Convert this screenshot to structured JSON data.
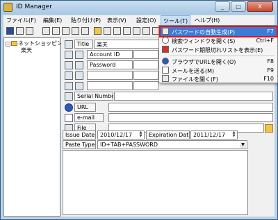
{
  "window": {
    "title": "ID Manager",
    "minimize": "_",
    "maximize": "□",
    "close": "X"
  },
  "menu": [
    "ファイル(F)",
    "編集(E)",
    "貼り付け(P)",
    "表示(V)",
    "設定(O)",
    "ツール(T)",
    "ヘルプ(H)"
  ],
  "tree": {
    "root": "ネットショッピング",
    "child": "楽天"
  },
  "form": {
    "title_label": "Title",
    "title_value": "楽天",
    "account_id_label": "Account ID",
    "password_label": "Password",
    "serial_label": "Serial Number",
    "url_label": "URL",
    "email_label": "e-mail",
    "file_label": "File",
    "issue_date_label": "Issue Date",
    "issue_date_value": "2010/12/17",
    "expiration_label": "Expiration Date",
    "expiration_value": "2011/12/17",
    "paste_type_label": "Paste Type",
    "paste_type_value": "ID+TAB+PASSWORD"
  },
  "tools_menu": [
    {
      "label": "パスワードの自動生成(P)",
      "shortcut": "F7"
    },
    {
      "label": "検索ウィンドウを開く(S)",
      "shortcut": "Ctrl+F"
    },
    {
      "label": "パスワード期限切れリストを表示(E)",
      "shortcut": ""
    },
    {
      "label": "ブラウザでURLを開く(O)",
      "shortcut": "F8"
    },
    {
      "label": "メールを送る(M)",
      "shortcut": "F9"
    },
    {
      "label": "ファイルを開く(F)",
      "shortcut": "F10"
    }
  ],
  "icons": {
    "toolbar": [
      "save-icon",
      "new-icon",
      "copy-icon",
      "id-icon",
      "pw-icon",
      "folder-icon"
    ],
    "row": [
      "key-icon",
      "globe-icon",
      "mail-icon",
      "file-icon"
    ]
  }
}
